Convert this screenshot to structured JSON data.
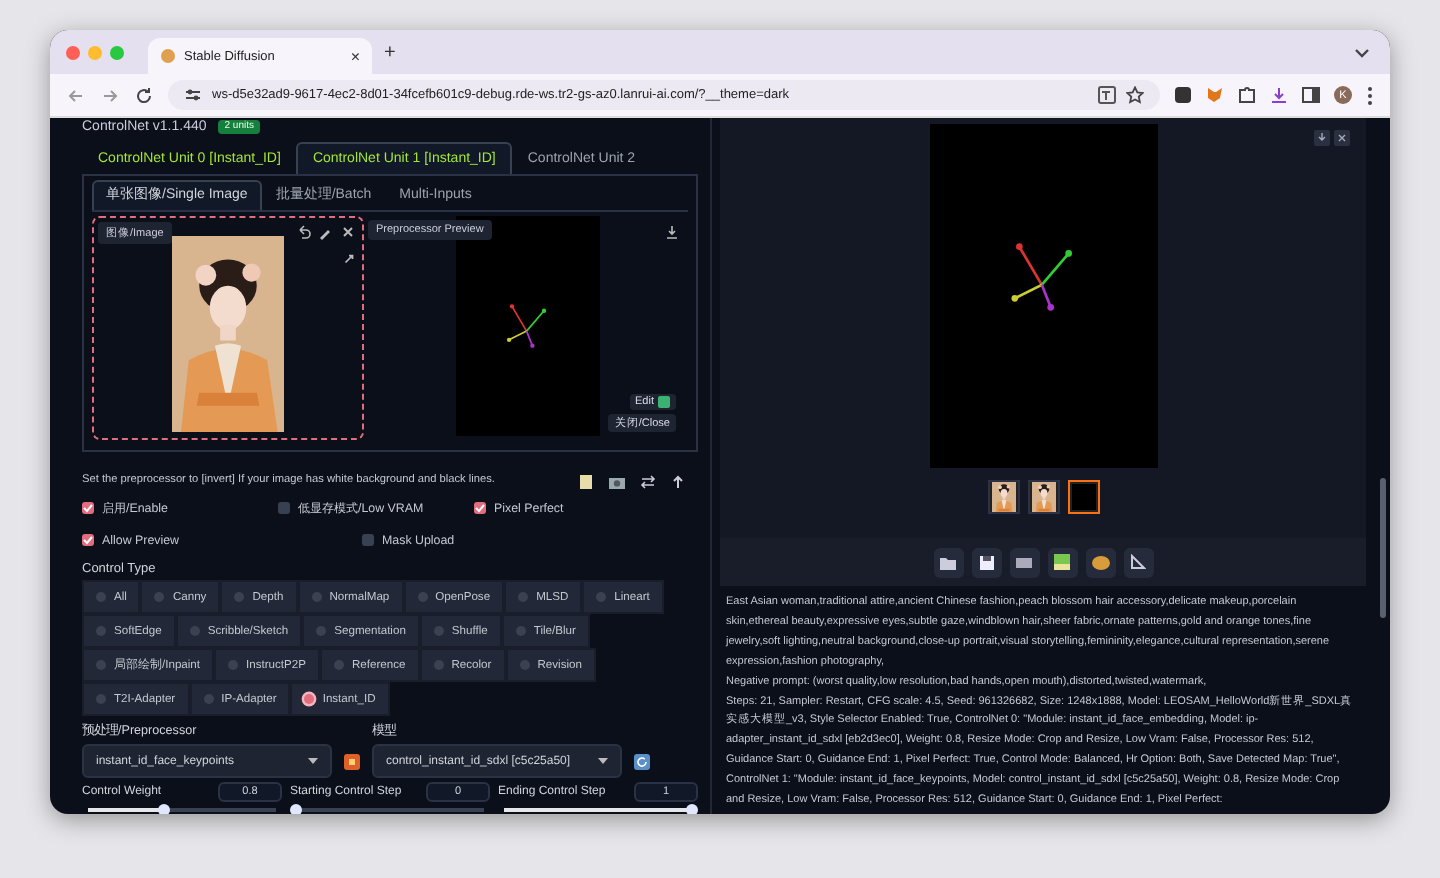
{
  "browser": {
    "tab_title": "Stable Diffusion",
    "tab_close": "×",
    "new_tab": "+",
    "url": "ws-d5e32ad9-9617-4ec2-8d01-34fcefb601c9-debug.rde-ws.tr2-gs-az0.lanrui-ai.com/?__theme=dark",
    "profile": "K"
  },
  "header": {
    "title": "ControlNet v1.1.440",
    "badge": "2 units"
  },
  "unit_tabs": [
    {
      "label": "ControlNet Unit 0 [Instant_ID]",
      "selected": false,
      "enabled": true
    },
    {
      "label": "ControlNet Unit 1 [Instant_ID]",
      "selected": true,
      "enabled": true
    },
    {
      "label": "ControlNet Unit 2",
      "selected": false,
      "enabled": false
    }
  ],
  "input_tabs": [
    {
      "label": "单张图像/Single Image",
      "selected": true
    },
    {
      "label": "批量处理/Batch",
      "selected": false
    },
    {
      "label": "Multi-Inputs",
      "selected": false
    }
  ],
  "image_input": {
    "label": "图像/Image",
    "image": {
      "kind": "picture"
    }
  },
  "preview": {
    "label": "Preprocessor Preview",
    "edit": "Edit",
    "close": "关闭/Close"
  },
  "hint": "Set the preprocessor to [invert] If your image has white background and black lines.",
  "option_rows": [
    {
      "items": [
        {
          "label": "启用/Enable",
          "checked": true
        },
        {
          "label": "低显存模式/Low VRAM",
          "checked": false
        },
        {
          "label": "Pixel Perfect",
          "checked": true
        }
      ]
    },
    {
      "items": [
        {
          "label": "Allow Preview",
          "checked": true
        },
        {
          "label": "Mask Upload",
          "checked": false
        }
      ]
    }
  ],
  "control_type": {
    "label": "Control Type",
    "rows": [
      {
        "options": [
          {
            "label": "All",
            "selected": false
          },
          {
            "label": "Canny",
            "selected": false
          },
          {
            "label": "Depth",
            "selected": false
          },
          {
            "label": "NormalMap",
            "selected": false
          },
          {
            "label": "OpenPose",
            "selected": false
          },
          {
            "label": "MLSD",
            "selected": false
          },
          {
            "label": "Lineart",
            "selected": false
          }
        ]
      },
      {
        "options": [
          {
            "label": "SoftEdge",
            "selected": false
          },
          {
            "label": "Scribble/Sketch",
            "selected": false
          },
          {
            "label": "Segmentation",
            "selected": false
          },
          {
            "label": "Shuffle",
            "selected": false
          },
          {
            "label": "Tile/Blur",
            "selected": false
          }
        ]
      },
      {
        "options": [
          {
            "label": "局部绘制/Inpaint",
            "selected": false
          },
          {
            "label": "InstructP2P",
            "selected": false
          },
          {
            "label": "Reference",
            "selected": false
          },
          {
            "label": "Recolor",
            "selected": false
          },
          {
            "label": "Revision",
            "selected": false
          }
        ]
      },
      {
        "options": [
          {
            "label": "T2I-Adapter",
            "selected": false
          },
          {
            "label": "IP-Adapter",
            "selected": false
          },
          {
            "label": "Instant_ID",
            "selected": true
          }
        ]
      }
    ]
  },
  "preprocessor": {
    "label": "预处理/Preprocessor",
    "value": "instant_id_face_keypoints"
  },
  "model": {
    "label": "模型",
    "value": "control_instant_id_sdxl [c5c25a50]"
  },
  "steps": [
    {
      "label": "Control Weight",
      "value": "0.8",
      "level": 0.4
    },
    {
      "label": "Starting Control Step",
      "value": "0",
      "level": 0
    },
    {
      "label": "Ending Control Step",
      "value": "1",
      "level": 1
    }
  ],
  "output": {
    "thumbnails": [
      {
        "kind": "picture",
        "selected": false
      },
      {
        "kind": "picture",
        "selected": false
      },
      {
        "kind": "pose",
        "selected": true
      }
    ],
    "info": [
      "East Asian woman,traditional attire,ancient Chinese fashion,peach blossom hair accessory,delicate makeup,porcelain skin,ethereal beauty,expressive eyes,subtle gaze,windblown hair,sheer fabric,ornate patterns,gold and orange tones,fine jewelry,soft lighting,neutral background,close-up portrait,visual storytelling,femininity,elegance,cultural representation,serene expression,fashion photography,",
      "Negative prompt: (worst quality,low resolution,bad hands,open mouth),distorted,twisted,watermark,",
      "Steps: 21, Sampler: Restart, CFG scale: 4.5, Seed: 961326682, Size: 1248x1888, Model: LEOSAM_HelloWorld新世界_SDXL真实感大模型_v3, Style Selector Enabled: True, ControlNet 0: \"Module: instant_id_face_embedding, Model: ip-adapter_instant_id_sdxl [eb2d3ec0], Weight: 0.8, Resize Mode: Crop and Resize, Low Vram: False, Processor Res: 512, Guidance Start: 0, Guidance End: 1, Pixel Perfect: True, Control Mode: Balanced, Hr Option: Both, Save Detected Map: True\", ControlNet 1: \"Module: instant_id_face_keypoints, Model: control_instant_id_sdxl [c5c25a50], Weight: 0.8, Resize Mode: Crop and Resize, Low Vram: False, Processor Res: 512, Guidance Start: 0, Guidance End: 1, Pixel Perfect:"
    ]
  }
}
